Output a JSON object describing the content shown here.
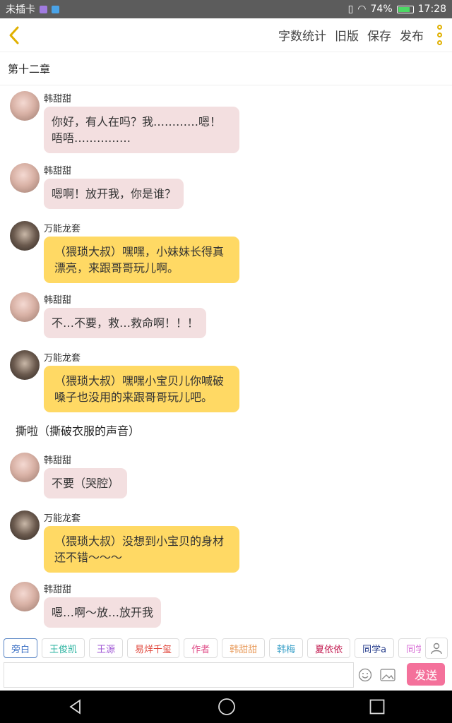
{
  "statusbar": {
    "carrier": "未插卡",
    "battery_pct": "74%",
    "time": "17:28",
    "battery_level": 0.74
  },
  "topbar": {
    "actions": [
      "字数统计",
      "旧版",
      "保存",
      "发布"
    ],
    "accent": "#e0b000"
  },
  "chapter": {
    "title": "第十二章"
  },
  "messages": [
    {
      "name": "韩甜甜",
      "text": "你好，有人在吗？我…………嗯！唔唔……………",
      "style": "pink"
    },
    {
      "name": "韩甜甜",
      "text": "嗯啊！放开我，你是谁？",
      "style": "pink"
    },
    {
      "name": "万能龙套",
      "text": "（猥琐大叔）嘿嘿，小妹妹长得真漂亮，来跟哥哥玩儿啊。",
      "style": "yellow"
    },
    {
      "name": "韩甜甜",
      "text": "不…不要，救…救命啊！！！",
      "style": "pink"
    },
    {
      "name": "万能龙套",
      "text": "（猥琐大叔）嘿嘿小宝贝儿你喊破嗓子也没用的来跟哥哥玩儿吧。",
      "style": "yellow"
    },
    {
      "name": "韩甜甜",
      "text": "不要（哭腔）",
      "style": "pink"
    },
    {
      "name": "万能龙套",
      "text": "（猥琐大叔）没想到小宝贝的身材还不错～～～",
      "style": "yellow"
    },
    {
      "name": "韩甜甜",
      "text": "嗯…啊～放…放开我",
      "style": "pink"
    }
  ],
  "narration": "撕啦（撕破衣服的声音）",
  "roles": [
    {
      "label": "旁白",
      "color": "#3a6fc4"
    },
    {
      "label": "王俊凯",
      "color": "#2bb3a0"
    },
    {
      "label": "王源",
      "color": "#a25ad6"
    },
    {
      "label": "易烊千玺",
      "color": "#e0473c"
    },
    {
      "label": "作者",
      "color": "#e0508a"
    },
    {
      "label": "韩甜甜",
      "color": "#e89a5a"
    },
    {
      "label": "韩梅",
      "color": "#3aa0c8"
    },
    {
      "label": "夏依依",
      "color": "#c2184f"
    },
    {
      "label": "同学a",
      "color": "#233a8a"
    },
    {
      "label": "同学",
      "color": "#d76fd6"
    }
  ],
  "composer": {
    "send_label": "发送",
    "placeholder": ""
  }
}
